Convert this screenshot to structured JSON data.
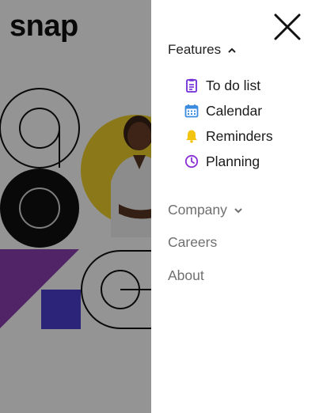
{
  "brand": {
    "logo_text": "snap"
  },
  "drawer": {
    "features": {
      "label": "Features",
      "expanded": true,
      "items": [
        {
          "label": "To do list",
          "icon": "todo-list-icon",
          "color": "#6f2bd9"
        },
        {
          "label": "Calendar",
          "icon": "calendar-icon",
          "color": "#3a8be0"
        },
        {
          "label": "Reminders",
          "icon": "bell-icon",
          "color": "#f2c40f"
        },
        {
          "label": "Planning",
          "icon": "clock-icon",
          "color": "#8a2fd6"
        }
      ]
    },
    "company": {
      "label": "Company",
      "expanded": false
    },
    "careers": {
      "label": "Careers"
    },
    "about": {
      "label": "About"
    }
  },
  "colors": {
    "overlay": "rgba(0,0,0,0.42)",
    "hero_yellow": "#f0cf2a",
    "hero_purple": "#8a3fb2",
    "hero_blue": "#4a3fd0"
  }
}
